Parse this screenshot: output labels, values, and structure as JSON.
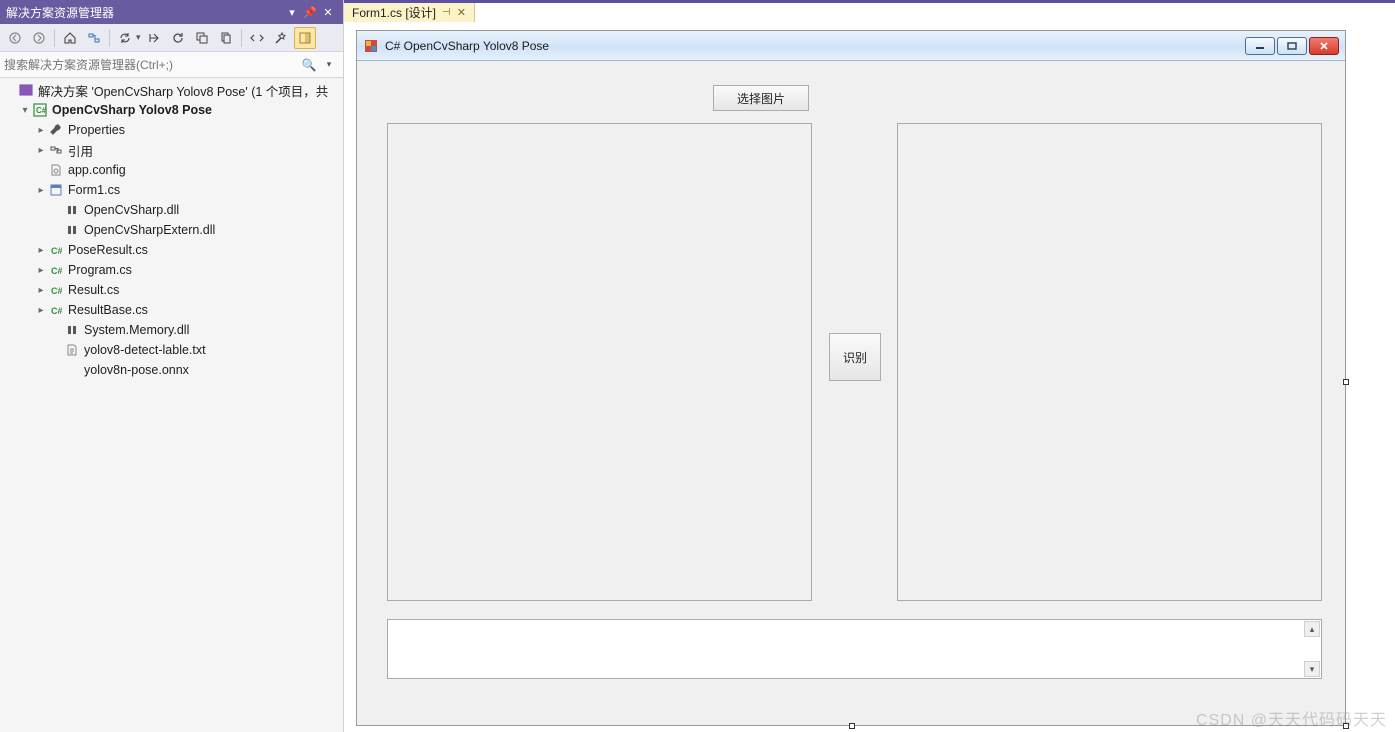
{
  "solution_explorer": {
    "title": "解决方案资源管理器",
    "search_placeholder": "搜索解决方案资源管理器(Ctrl+;)",
    "solution_label": "解决方案 'OpenCvSharp Yolov8 Pose' (1 个项目，共",
    "project_label": "OpenCvSharp Yolov8 Pose",
    "items": {
      "properties": "Properties",
      "references": "引用",
      "app_config": "app.config",
      "form1": "Form1.cs",
      "opencvsharp_dll": "OpenCvSharp.dll",
      "opencvsharpextern_dll": "OpenCvSharpExtern.dll",
      "poseresult": "PoseResult.cs",
      "program": "Program.cs",
      "result": "Result.cs",
      "resultbase": "ResultBase.cs",
      "system_memory_dll": "System.Memory.dll",
      "yolov8_label_txt": "yolov8-detect-lable.txt",
      "yolov8n_pose_onnx": "yolov8n-pose.onnx"
    }
  },
  "editor": {
    "tab_label": "Form1.cs [设计]"
  },
  "form": {
    "title": "C# OpenCvSharp Yolov8 Pose",
    "btn_select_image": "选择图片",
    "btn_recognize": "识别"
  },
  "watermark": "CSDN @天天代码码天天"
}
